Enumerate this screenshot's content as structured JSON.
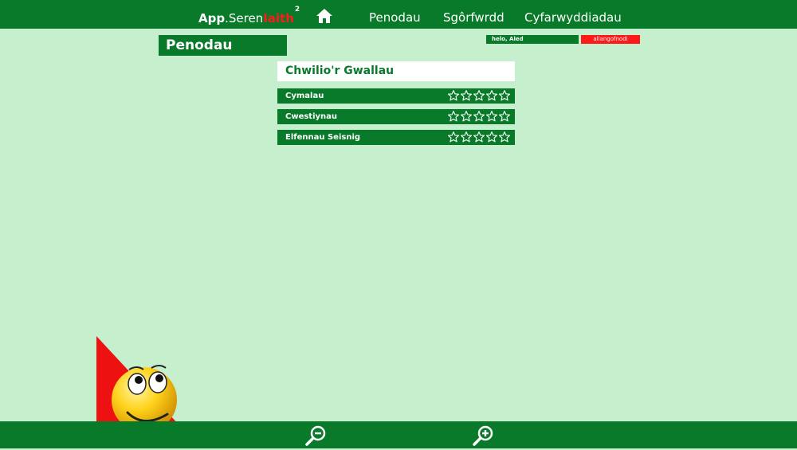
{
  "app": {
    "brand_part1": "App",
    "brand_part2": ".Seren",
    "brand_part3": "Iaith",
    "brand_sup": "2"
  },
  "nav": {
    "home_icon": "home-icon",
    "links": [
      {
        "label": "Penodau"
      },
      {
        "label": "Sgôrfwrdd"
      },
      {
        "label": "Cyfarwyddiadau"
      }
    ]
  },
  "header": {
    "section_title": "Penodau",
    "greeting": "helo, Aled",
    "logout_label": "allangofnodi"
  },
  "panel": {
    "title": "Chwilio'r Gwallau",
    "chapters": [
      {
        "label": "Cymalau",
        "stars_filled": 0,
        "stars_total": 5
      },
      {
        "label": "Cwestiynau",
        "stars_filled": 0,
        "stars_total": 5
      },
      {
        "label": "Elfennau Seisnig",
        "stars_filled": 0,
        "stars_total": 5
      }
    ]
  },
  "footer": {
    "zoom_out_icon": "zoom-out-icon",
    "zoom_in_icon": "zoom-in-icon"
  },
  "colors": {
    "primary_green": "#087a2a",
    "background": "#c6efcd",
    "accent_red": "#ff1a1a",
    "white": "#ffffff"
  }
}
